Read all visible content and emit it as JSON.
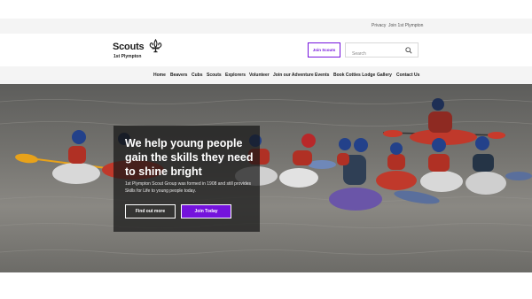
{
  "utility_nav": {
    "privacy": "Privacy",
    "join": "Join 1st Plympton"
  },
  "brand": {
    "name": "Scouts",
    "group": "1st Plympton",
    "logo_icon": "fleur-de-lis-icon"
  },
  "header": {
    "join_button": "Join Scouts",
    "search_placeholder": "Search",
    "search_icon": "search-icon"
  },
  "main_nav": [
    "Home",
    "Beavers",
    "Cubs",
    "Scouts",
    "Explorers",
    "Volunteer",
    "Join our Adventure",
    "Events",
    "Book Cotties Lodge",
    "Gallery",
    "Contact Us"
  ],
  "hero": {
    "title": "We help young people gain the skills they need to shine bright",
    "text": "1st Plympton Scout Group was formed in 1908 and still provides Skills for Life to young people today.",
    "button_primary": "Find out more",
    "button_secondary": "Join Today"
  },
  "colors": {
    "brand_purple": "#7413dc",
    "panel_bg": "#161616",
    "nav_bg": "#f4f4f4"
  }
}
